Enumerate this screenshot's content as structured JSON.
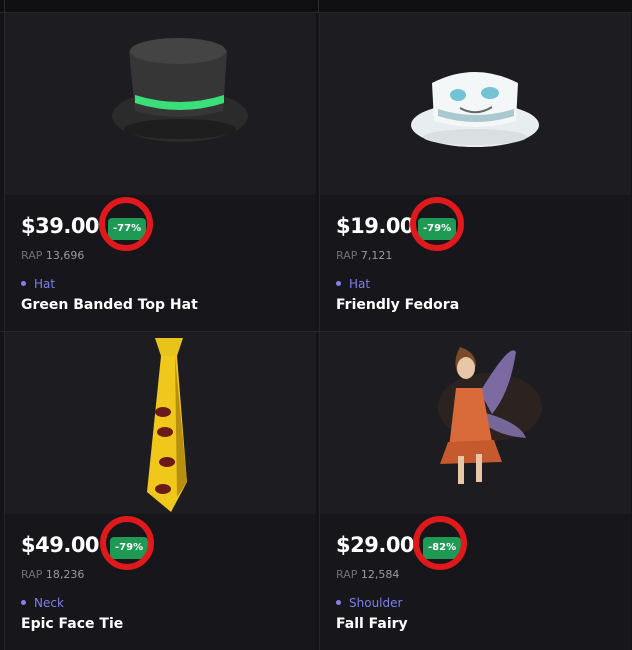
{
  "items": [
    {
      "price": "$39.00",
      "discount": "-77%",
      "rap_label": "RAP",
      "rap_value": "13,696",
      "category": "Hat",
      "name": "Green Banded Top Hat",
      "image_icon": "top-hat"
    },
    {
      "price": "$19.00",
      "discount": "-79%",
      "rap_label": "RAP",
      "rap_value": "7,121",
      "category": "Hat",
      "name": "Friendly Fedora",
      "image_icon": "fedora"
    },
    {
      "price": "$49.00",
      "discount": "-79%",
      "rap_label": "RAP",
      "rap_value": "18,236",
      "category": "Neck",
      "name": "Epic Face Tie",
      "image_icon": "tie"
    },
    {
      "price": "$29.00",
      "discount": "-82%",
      "rap_label": "RAP",
      "rap_value": "12,584",
      "category": "Shoulder",
      "name": "Fall Fairy",
      "image_icon": "fairy"
    }
  ],
  "colors": {
    "background": "#141418",
    "card": "#16161b",
    "image_bg": "#1c1c21",
    "badge": "#1f9a55",
    "highlight_circle": "#e0191c",
    "category_text": "#7f7fe8"
  }
}
